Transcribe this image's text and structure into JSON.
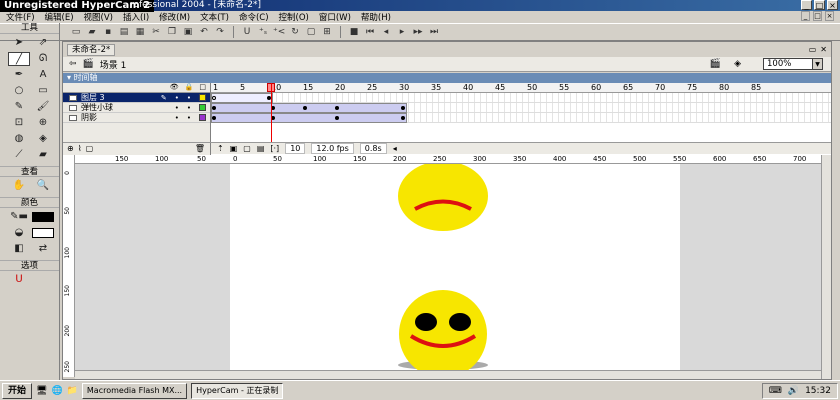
{
  "window": {
    "hypercam_label": "Unregistered HyperCam 2",
    "title_rest": "rofessional 2004 - [未命名-2*]",
    "controls": [
      "_",
      "□",
      "×"
    ]
  },
  "menu": [
    "文件(F)",
    "编辑(E)",
    "视图(V)",
    "插入(I)",
    "修改(M)",
    "文本(T)",
    "命令(C)",
    "控制(O)",
    "窗口(W)",
    "帮助(H)"
  ],
  "menu_right": [
    "_",
    "□",
    "×"
  ],
  "tools": {
    "header": "工具",
    "view_header": "查看",
    "color_header": "颜色",
    "options_header": "选项"
  },
  "document": {
    "tab": "未命名-2*",
    "scene": "场景 1",
    "zoom": "100%",
    "timeline_label": "时间轴"
  },
  "layers": [
    {
      "name": "图层 3",
      "color": "#f7e600",
      "selected": true
    },
    {
      "name": "弹性小球",
      "color": "#33cc33",
      "selected": false
    },
    {
      "name": "阴影",
      "color": "#9933cc",
      "selected": false
    }
  ],
  "frame_numbers": [
    "1",
    "5",
    "10",
    "15",
    "20",
    "25",
    "30",
    "35",
    "40",
    "45",
    "50",
    "55",
    "60",
    "65",
    "70",
    "75",
    "80",
    "85"
  ],
  "timeline_status": {
    "current_frame": "10",
    "fps": "12.0 fps",
    "time": "0.8s"
  },
  "ruler_h": [
    "150",
    "100",
    "50",
    "0",
    "50",
    "100",
    "150",
    "200",
    "250",
    "300",
    "350",
    "400",
    "450",
    "500",
    "550",
    "600",
    "650",
    "700"
  ],
  "ruler_v": [
    "0",
    "50",
    "100",
    "150",
    "200",
    "250"
  ],
  "taskbar": {
    "start": "开始",
    "tasks": [
      "Macromedia Flash MX...",
      "HyperCam - 正在录制"
    ],
    "clock": "15:32"
  },
  "colors": {
    "face": "#f7e600",
    "mouth": "#dd1111",
    "eyes": "#000000",
    "shadow": "#aaaaaa"
  }
}
